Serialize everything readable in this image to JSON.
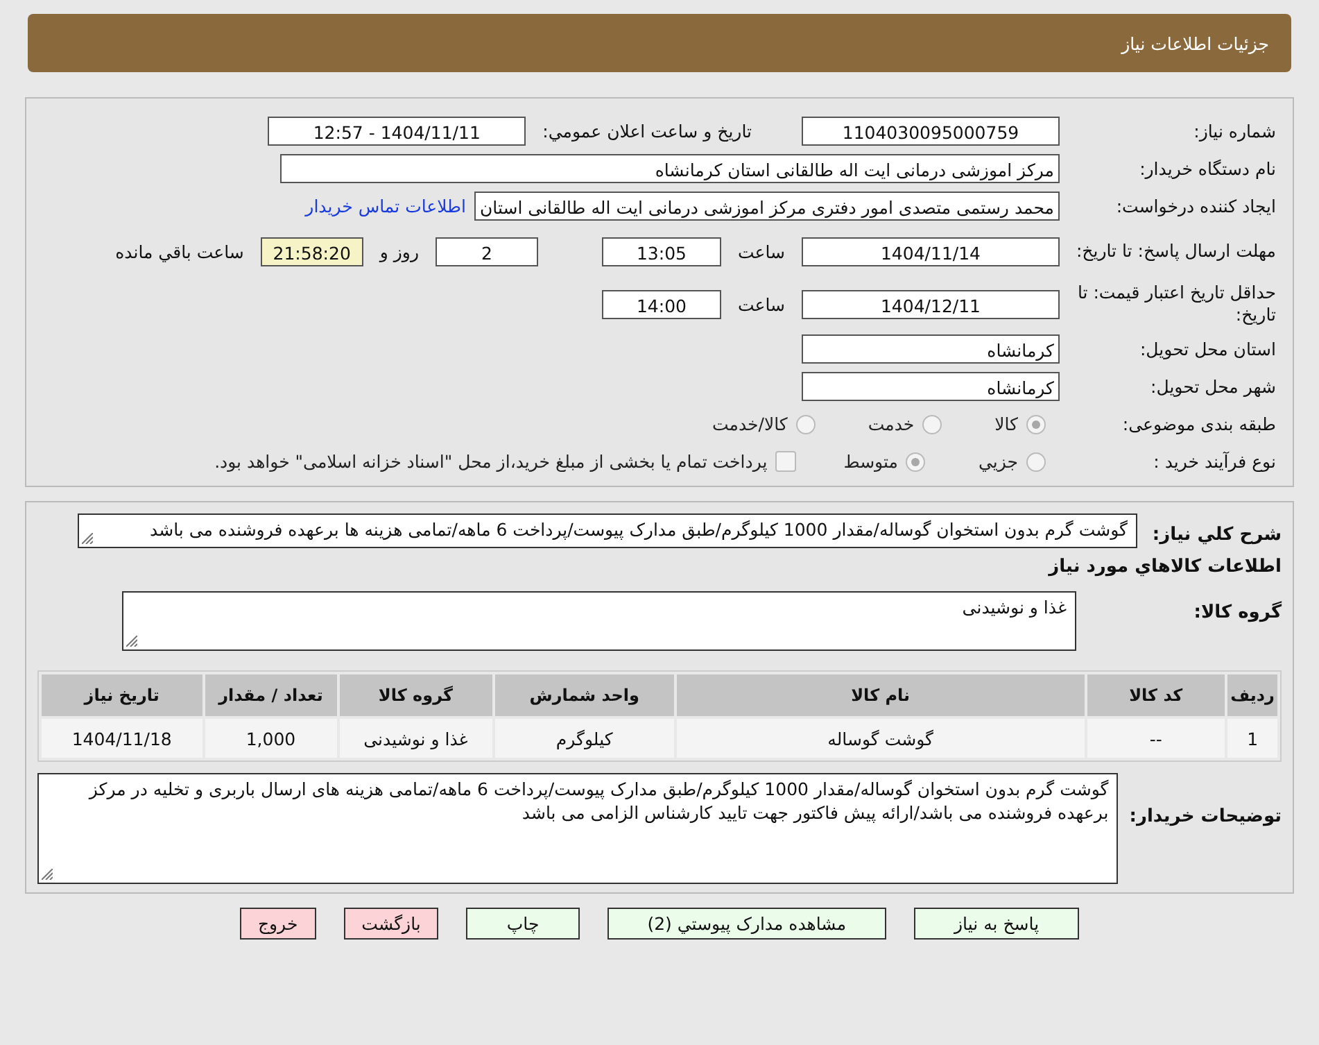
{
  "header": {
    "title": "جزئیات اطلاعات نیاز"
  },
  "need_number": {
    "label": "شماره نیاز:",
    "value": "1104030095000759"
  },
  "announce": {
    "label": "تاریخ و ساعت اعلان عمومي:",
    "value": "1404/11/11 - 12:57"
  },
  "buyer": {
    "label": "نام دستگاه خریدار:",
    "value": "مرکز اموزشی درمانی ایت اله طالقانی استان کرمانشاه"
  },
  "requester": {
    "label": "ایجاد کننده درخواست:",
    "value": "محمد رستمی متصدی امور دفتری مرکز اموزشی درمانی ایت اله طالقانی استان",
    "link": "اطلاعات تماس خریدار"
  },
  "reply_deadline": {
    "label": "مهلت ارسال پاسخ: تا تاریخ:",
    "date": "1404/11/14",
    "time_label": "ساعت",
    "time": "13:05",
    "days": "2",
    "days_label": "روز و",
    "remaining": "21:58:20",
    "remaining_label": "ساعت باقي مانده"
  },
  "price_validity": {
    "label": "حداقل تاریخ اعتبار قیمت: تا تاریخ:",
    "date": "1404/12/11",
    "time_label": "ساعت",
    "time": "14:00"
  },
  "province": {
    "label": "استان محل تحویل:",
    "value": "کرمانشاه"
  },
  "city": {
    "label": "شهر محل تحویل:",
    "value": "کرمانشاه"
  },
  "category": {
    "label": "طبقه بندی موضوعی:",
    "options": [
      {
        "label": "کالا",
        "selected": true
      },
      {
        "label": "خدمت",
        "selected": false
      },
      {
        "label": "کالا/خدمت",
        "selected": false
      }
    ]
  },
  "process": {
    "label": "نوع فرآیند خرید :",
    "options": [
      {
        "label": "جزيي",
        "selected": false
      },
      {
        "label": "متوسط",
        "selected": true
      }
    ],
    "treasury": {
      "label": "پرداخت تمام یا بخشی از مبلغ خرید،از محل \"اسناد خزانه اسلامی\" خواهد بود.",
      "checked": false
    }
  },
  "summary": {
    "label": "شرح کلي نیاز:",
    "value": "گوشت گرم بدون استخوان گوساله/مقدار 1000 کیلوگرم/طبق مدارک پیوست/پرداخت 6 ماهه/تمامی هزینه ها برعهده فروشنده می باشد"
  },
  "goods_title": "اطلاعات کالاهاي مورد نیاز",
  "goods_group": {
    "label": "گروه کالا:",
    "value": "غذا و نوشیدنی"
  },
  "table": {
    "columns": [
      "ردیف",
      "کد کالا",
      "نام کالا",
      "واحد شمارش",
      "گروه کالا",
      "تعداد / مقدار",
      "تاریخ نیاز"
    ],
    "rows": [
      [
        "1",
        "--",
        "گوشت گوساله",
        "کیلوگرم",
        "غذا و نوشیدنی",
        "1,000",
        "1404/11/18"
      ]
    ]
  },
  "buyer_notes": {
    "label": "توضیحات خریدار:",
    "value": "گوشت گرم بدون استخوان گوساله/مقدار 1000 کیلوگرم/طبق مدارک پیوست/پرداخت 6 ماهه/تمامی هزینه های ارسال باربری و تخلیه در مرکز برعهده فروشنده می باشد/ارائه پیش فاکتور جهت تایید کارشناس الزامی می باشد"
  },
  "buttons": [
    {
      "label": "پاسخ به نیاز",
      "kind": "action"
    },
    {
      "label": "مشاهده مدارک پیوستي (2)",
      "kind": "action"
    },
    {
      "label": "چاپ",
      "kind": "action"
    },
    {
      "label": "بازگشت",
      "kind": "exit"
    },
    {
      "label": "خروج",
      "kind": "exit"
    }
  ]
}
